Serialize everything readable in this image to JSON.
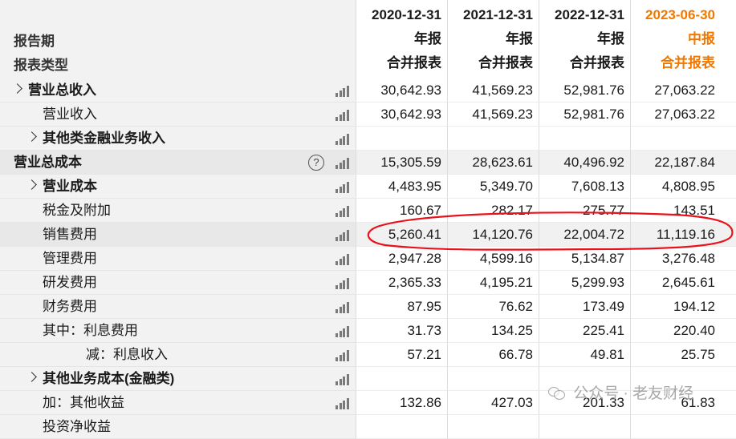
{
  "header": {
    "label_period": "报告期",
    "label_type": "报表类型",
    "columns": [
      {
        "date": "2020-12-31",
        "period": "年报",
        "type": "合并报表"
      },
      {
        "date": "2021-12-31",
        "period": "年报",
        "type": "合并报表"
      },
      {
        "date": "2022-12-31",
        "period": "年报",
        "type": "合并报表"
      },
      {
        "date": "2023-06-30",
        "period": "中报",
        "type": "合并报表"
      }
    ]
  },
  "rows": [
    {
      "label": "营业总收入",
      "v": [
        "30,642.93",
        "41,569.23",
        "52,981.76",
        "27,063.22"
      ]
    },
    {
      "label": "营业收入",
      "v": [
        "30,642.93",
        "41,569.23",
        "52,981.76",
        "27,063.22"
      ]
    },
    {
      "label": "其他类金融业务收入",
      "v": [
        "",
        "",
        "",
        ""
      ]
    },
    {
      "label": "营业总成本",
      "v": [
        "15,305.59",
        "28,623.61",
        "40,496.92",
        "22,187.84"
      ]
    },
    {
      "label": "营业成本",
      "v": [
        "4,483.95",
        "5,349.70",
        "7,608.13",
        "4,808.95"
      ]
    },
    {
      "label": "税金及附加",
      "v": [
        "160.67",
        "282.17",
        "275.77",
        "143.51"
      ]
    },
    {
      "label": "销售费用",
      "v": [
        "5,260.41",
        "14,120.76",
        "22,004.72",
        "11,119.16"
      ]
    },
    {
      "label": "管理费用",
      "v": [
        "2,947.28",
        "4,599.16",
        "5,134.87",
        "3,276.48"
      ]
    },
    {
      "label": "研发费用",
      "v": [
        "2,365.33",
        "4,195.21",
        "5,299.93",
        "2,645.61"
      ]
    },
    {
      "label": "财务费用",
      "v": [
        "87.95",
        "76.62",
        "173.49",
        "194.12"
      ]
    },
    {
      "label": "其中：利息费用",
      "v": [
        "31.73",
        "134.25",
        "225.41",
        "220.40"
      ]
    },
    {
      "label": "减：利息收入",
      "v": [
        "57.21",
        "66.78",
        "49.81",
        "25.75"
      ]
    },
    {
      "label": "其他业务成本(金融类)",
      "v": [
        "",
        "",
        "",
        ""
      ]
    },
    {
      "label": "加：其他收益",
      "v": [
        "132.86",
        "427.03",
        "201.33",
        "61.83"
      ]
    },
    {
      "label": "投资净收益",
      "v": [
        "",
        "",
        "",
        ""
      ]
    }
  ],
  "watermark": "公众号 · 老友财经",
  "colors": {
    "accent": "#f07800",
    "annotation": "#e8121c"
  },
  "icons": {
    "expand": "chevron-right-icon",
    "chart": "bar-chart-icon",
    "help": "help-circle-icon"
  }
}
